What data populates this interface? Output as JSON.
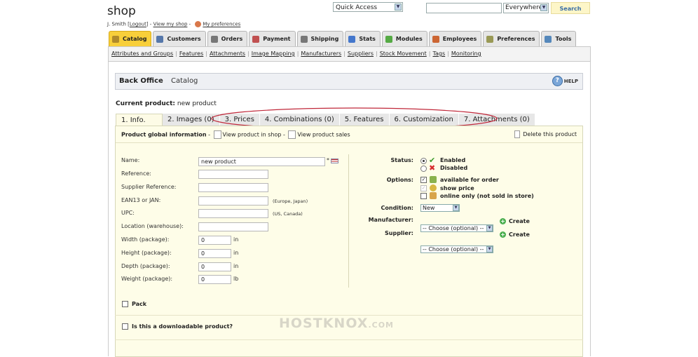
{
  "header": {
    "shop_title": "shop",
    "user": "J. Smith",
    "logout": "Logout",
    "view_shop": "View my shop",
    "preferences": "My preferences",
    "quick_access": "Quick Access",
    "search_scope": "Everywhere",
    "search_button": "Search"
  },
  "main_tabs": [
    {
      "label": "Catalog",
      "icon": "catalog-icon",
      "color": "#b08a2a"
    },
    {
      "label": "Customers",
      "icon": "customers-icon",
      "color": "#5577aa"
    },
    {
      "label": "Orders",
      "icon": "orders-icon",
      "color": "#777777"
    },
    {
      "label": "Payment",
      "icon": "payment-icon",
      "color": "#c05050"
    },
    {
      "label": "Shipping",
      "icon": "shipping-icon",
      "color": "#777777"
    },
    {
      "label": "Stats",
      "icon": "stats-icon",
      "color": "#4477cc"
    },
    {
      "label": "Modules",
      "icon": "modules-icon",
      "color": "#55aa44"
    },
    {
      "label": "Employees",
      "icon": "employees-icon",
      "color": "#cc6633"
    },
    {
      "label": "Preferences",
      "icon": "preferences-icon",
      "color": "#999955"
    },
    {
      "label": "Tools",
      "icon": "tools-icon",
      "color": "#5588bb"
    }
  ],
  "subnav": [
    "Attributes and Groups",
    "Features",
    "Attachments",
    "Image Mapping",
    "Manufacturers",
    "Suppliers",
    "Stock Movement",
    "Tags",
    "Monitoring"
  ],
  "breadcrumb": {
    "home": "Back Office",
    "current": "Catalog",
    "help": "HELP"
  },
  "current_product": {
    "label": "Current product:",
    "value": "new product"
  },
  "product_tabs": [
    "1. Info.",
    "2. Images (0)",
    "3. Prices",
    "4. Combinations (0)",
    "5. Features",
    "6. Customization",
    "7. Attachments (0)"
  ],
  "panel_header": {
    "title": "Product global information",
    "view_in_shop": "View product in shop",
    "view_sales": "View product sales",
    "delete": "Delete this product"
  },
  "fields": {
    "name": {
      "label": "Name:",
      "value": "new product",
      "required": "*"
    },
    "reference": {
      "label": "Reference:",
      "value": ""
    },
    "supplier_reference": {
      "label": "Supplier Reference:",
      "value": ""
    },
    "ean13": {
      "label": "EAN13 or JAN:",
      "value": "",
      "hint": "(Europe, Japan)"
    },
    "upc": {
      "label": "UPC:",
      "value": "",
      "hint": "(US, Canada)"
    },
    "location": {
      "label": "Location (warehouse):",
      "value": ""
    },
    "width": {
      "label": "Width (package):",
      "value": "0",
      "unit": "in"
    },
    "height": {
      "label": "Height (package):",
      "value": "0",
      "unit": "in"
    },
    "depth": {
      "label": "Depth (package):",
      "value": "0",
      "unit": "in"
    },
    "weight": {
      "label": "Weight (package):",
      "value": "0",
      "unit": "lb"
    }
  },
  "right": {
    "status_label": "Status:",
    "enabled": "Enabled",
    "disabled": "Disabled",
    "options_label": "Options:",
    "available": "available for order",
    "show_price": "show price",
    "online_only": "online only (not sold in store)",
    "condition_label": "Condition:",
    "condition_value": "New",
    "manufacturer_label": "Manufacturer:",
    "manufacturer_value": "-- Choose (optional) --",
    "supplier_label": "Supplier:",
    "supplier_value": "-- Choose (optional) --",
    "create": "Create"
  },
  "sections": {
    "pack": "Pack",
    "downloadable": "Is this a downloadable product?"
  },
  "watermark": {
    "brand": "HOSTKNOX",
    "tld": ".COM"
  },
  "colors": {
    "active_tab": "#f8cf3a",
    "panel_bg": "#fefde8",
    "highlight_ellipse": "#c0283a"
  }
}
